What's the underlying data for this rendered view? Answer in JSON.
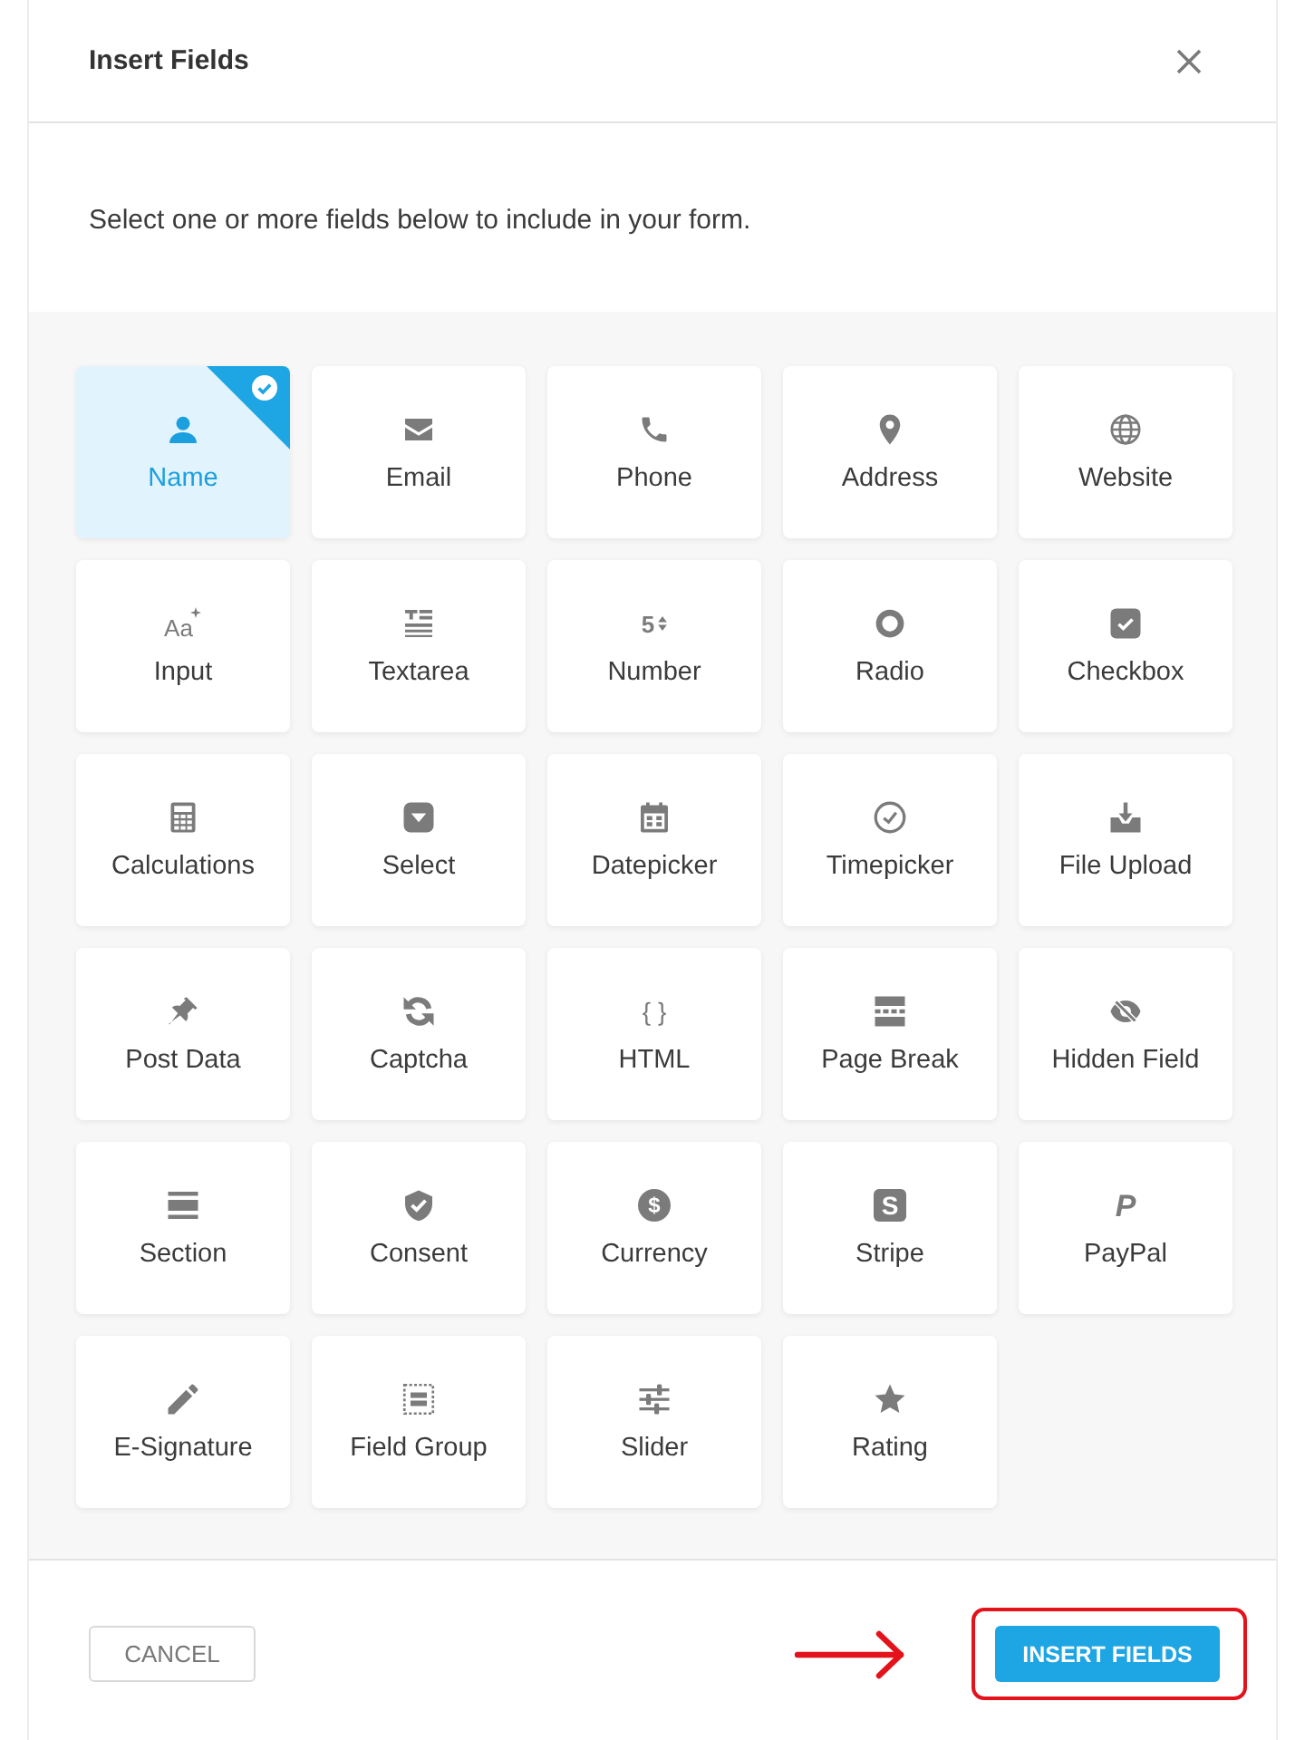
{
  "dialog": {
    "title": "Insert Fields",
    "intro": "Select one or more fields below to include in your form."
  },
  "fields": [
    {
      "label": "Name",
      "kind": "name",
      "selected": true
    },
    {
      "label": "Email",
      "kind": "email",
      "selected": false
    },
    {
      "label": "Phone",
      "kind": "phone",
      "selected": false
    },
    {
      "label": "Address",
      "kind": "address",
      "selected": false
    },
    {
      "label": "Website",
      "kind": "website",
      "selected": false
    },
    {
      "label": "Input",
      "kind": "input",
      "glyph": "Aa",
      "selected": false
    },
    {
      "label": "Textarea",
      "kind": "textarea",
      "selected": false
    },
    {
      "label": "Number",
      "kind": "number",
      "glyph": "5",
      "selected": false
    },
    {
      "label": "Radio",
      "kind": "radio",
      "selected": false
    },
    {
      "label": "Checkbox",
      "kind": "checkbox",
      "selected": false
    },
    {
      "label": "Calculations",
      "kind": "calculations",
      "selected": false
    },
    {
      "label": "Select",
      "kind": "select",
      "selected": false
    },
    {
      "label": "Datepicker",
      "kind": "datepicker",
      "selected": false
    },
    {
      "label": "Timepicker",
      "kind": "timepicker",
      "selected": false
    },
    {
      "label": "File Upload",
      "kind": "upload",
      "selected": false
    },
    {
      "label": "Post Data",
      "kind": "postdata",
      "selected": false
    },
    {
      "label": "Captcha",
      "kind": "captcha",
      "selected": false
    },
    {
      "label": "HTML",
      "kind": "html",
      "glyph": "{ }",
      "selected": false
    },
    {
      "label": "Page Break",
      "kind": "pagebreak",
      "selected": false
    },
    {
      "label": "Hidden Field",
      "kind": "hidden",
      "selected": false
    },
    {
      "label": "Section",
      "kind": "section",
      "selected": false
    },
    {
      "label": "Consent",
      "kind": "consent",
      "selected": false
    },
    {
      "label": "Currency",
      "kind": "currency",
      "glyph": "$",
      "selected": false
    },
    {
      "label": "Stripe",
      "kind": "stripe",
      "glyph": "S",
      "selected": false
    },
    {
      "label": "PayPal",
      "kind": "paypal",
      "glyph": "P",
      "selected": false
    },
    {
      "label": "E-Signature",
      "kind": "signature",
      "selected": false
    },
    {
      "label": "Field Group",
      "kind": "group",
      "selected": false
    },
    {
      "label": "Slider",
      "kind": "slider",
      "selected": false
    },
    {
      "label": "Rating",
      "kind": "rating",
      "selected": false
    }
  ],
  "footer": {
    "cancel": "CANCEL",
    "submit": {
      "label": "INSERT FIELDS",
      "highlighted": true
    }
  }
}
